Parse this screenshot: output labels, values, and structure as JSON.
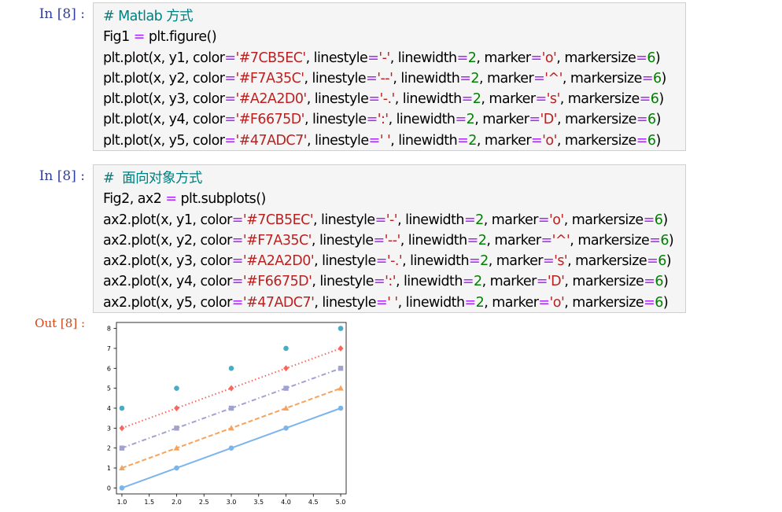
{
  "cells": [
    {
      "prompt": "In [8] :",
      "lines": [
        [
          {
            "t": "# Matlab 方式",
            "c": "comment"
          }
        ],
        [
          {
            "t": "Fig1 "
          },
          {
            "t": "=",
            "c": "op"
          },
          {
            "t": " plt.figure()"
          }
        ],
        [
          {
            "t": "plt.plot(x, y1, color"
          },
          {
            "t": "=",
            "c": "op"
          },
          {
            "t": "'#7CB5EC'",
            "c": "str"
          },
          {
            "t": ", linestyle"
          },
          {
            "t": "=",
            "c": "op"
          },
          {
            "t": "'-'",
            "c": "str"
          },
          {
            "t": ", linewidth"
          },
          {
            "t": "=",
            "c": "op"
          },
          {
            "t": "2",
            "c": "num"
          },
          {
            "t": ", marker"
          },
          {
            "t": "=",
            "c": "op"
          },
          {
            "t": "'o'",
            "c": "str"
          },
          {
            "t": ", markersize"
          },
          {
            "t": "=",
            "c": "op"
          },
          {
            "t": "6",
            "c": "num"
          },
          {
            "t": ")"
          }
        ],
        [
          {
            "t": "plt.plot(x, y2, color"
          },
          {
            "t": "=",
            "c": "op"
          },
          {
            "t": "'#F7A35C'",
            "c": "str"
          },
          {
            "t": ", linestyle"
          },
          {
            "t": "=",
            "c": "op"
          },
          {
            "t": "'--'",
            "c": "str"
          },
          {
            "t": ", linewidth"
          },
          {
            "t": "=",
            "c": "op"
          },
          {
            "t": "2",
            "c": "num"
          },
          {
            "t": ", marker"
          },
          {
            "t": "=",
            "c": "op"
          },
          {
            "t": "'^'",
            "c": "str"
          },
          {
            "t": ", markersize"
          },
          {
            "t": "=",
            "c": "op"
          },
          {
            "t": "6",
            "c": "num"
          },
          {
            "t": ")"
          }
        ],
        [
          {
            "t": "plt.plot(x, y3, color"
          },
          {
            "t": "=",
            "c": "op"
          },
          {
            "t": "'#A2A2D0'",
            "c": "str"
          },
          {
            "t": ", linestyle"
          },
          {
            "t": "=",
            "c": "op"
          },
          {
            "t": "'-.'",
            "c": "str"
          },
          {
            "t": ", linewidth"
          },
          {
            "t": "=",
            "c": "op"
          },
          {
            "t": "2",
            "c": "num"
          },
          {
            "t": ", marker"
          },
          {
            "t": "=",
            "c": "op"
          },
          {
            "t": "'s'",
            "c": "str"
          },
          {
            "t": ", markersize"
          },
          {
            "t": "=",
            "c": "op"
          },
          {
            "t": "6",
            "c": "num"
          },
          {
            "t": ")"
          }
        ],
        [
          {
            "t": "plt.plot(x, y4, color"
          },
          {
            "t": "=",
            "c": "op"
          },
          {
            "t": "'#F6675D'",
            "c": "str"
          },
          {
            "t": ", linestyle"
          },
          {
            "t": "=",
            "c": "op"
          },
          {
            "t": "':'",
            "c": "str"
          },
          {
            "t": ", linewidth"
          },
          {
            "t": "=",
            "c": "op"
          },
          {
            "t": "2",
            "c": "num"
          },
          {
            "t": ", marker"
          },
          {
            "t": "=",
            "c": "op"
          },
          {
            "t": "'D'",
            "c": "str"
          },
          {
            "t": ", markersize"
          },
          {
            "t": "=",
            "c": "op"
          },
          {
            "t": "6",
            "c": "num"
          },
          {
            "t": ")"
          }
        ],
        [
          {
            "t": "plt.plot(x, y5, color"
          },
          {
            "t": "=",
            "c": "op"
          },
          {
            "t": "'#47ADC7'",
            "c": "str"
          },
          {
            "t": ", linestyle"
          },
          {
            "t": "=",
            "c": "op"
          },
          {
            "t": "' '",
            "c": "str"
          },
          {
            "t": ", linewidth"
          },
          {
            "t": "=",
            "c": "op"
          },
          {
            "t": "2",
            "c": "num"
          },
          {
            "t": ", marker"
          },
          {
            "t": "=",
            "c": "op"
          },
          {
            "t": "'o'",
            "c": "str"
          },
          {
            "t": ", markersize"
          },
          {
            "t": "=",
            "c": "op"
          },
          {
            "t": "6",
            "c": "num"
          },
          {
            "t": ")"
          }
        ]
      ]
    },
    {
      "prompt": "In [8] :",
      "lines": [
        [
          {
            "t": "#  面向对象方式",
            "c": "comment"
          }
        ],
        [
          {
            "t": "Fig2, ax2 "
          },
          {
            "t": "=",
            "c": "op"
          },
          {
            "t": " plt.subplots()"
          }
        ],
        [
          {
            "t": "ax2.plot(x, y1, color"
          },
          {
            "t": "=",
            "c": "op"
          },
          {
            "t": "'#7CB5EC'",
            "c": "str"
          },
          {
            "t": ", linestyle"
          },
          {
            "t": "=",
            "c": "op"
          },
          {
            "t": "'-'",
            "c": "str"
          },
          {
            "t": ", linewidth"
          },
          {
            "t": "=",
            "c": "op"
          },
          {
            "t": "2",
            "c": "num"
          },
          {
            "t": ", marker"
          },
          {
            "t": "=",
            "c": "op"
          },
          {
            "t": "'o'",
            "c": "str"
          },
          {
            "t": ", markersize"
          },
          {
            "t": "=",
            "c": "op"
          },
          {
            "t": "6",
            "c": "num"
          },
          {
            "t": ")"
          }
        ],
        [
          {
            "t": "ax2.plot(x, y2, color"
          },
          {
            "t": "=",
            "c": "op"
          },
          {
            "t": "'#F7A35C'",
            "c": "str"
          },
          {
            "t": ", linestyle"
          },
          {
            "t": "=",
            "c": "op"
          },
          {
            "t": "'--'",
            "c": "str"
          },
          {
            "t": ", linewidth"
          },
          {
            "t": "=",
            "c": "op"
          },
          {
            "t": "2",
            "c": "num"
          },
          {
            "t": ", marker"
          },
          {
            "t": "=",
            "c": "op"
          },
          {
            "t": "'^'",
            "c": "str"
          },
          {
            "t": ", markersize"
          },
          {
            "t": "=",
            "c": "op"
          },
          {
            "t": "6",
            "c": "num"
          },
          {
            "t": ")"
          }
        ],
        [
          {
            "t": "ax2.plot(x, y3, color"
          },
          {
            "t": "=",
            "c": "op"
          },
          {
            "t": "'#A2A2D0'",
            "c": "str"
          },
          {
            "t": ", linestyle"
          },
          {
            "t": "=",
            "c": "op"
          },
          {
            "t": "'-.'",
            "c": "str"
          },
          {
            "t": ", linewidth"
          },
          {
            "t": "=",
            "c": "op"
          },
          {
            "t": "2",
            "c": "num"
          },
          {
            "t": ", marker"
          },
          {
            "t": "=",
            "c": "op"
          },
          {
            "t": "'s'",
            "c": "str"
          },
          {
            "t": ", markersize"
          },
          {
            "t": "=",
            "c": "op"
          },
          {
            "t": "6",
            "c": "num"
          },
          {
            "t": ")"
          }
        ],
        [
          {
            "t": "ax2.plot(x, y4, color"
          },
          {
            "t": "=",
            "c": "op"
          },
          {
            "t": "'#F6675D'",
            "c": "str"
          },
          {
            "t": ", linestyle"
          },
          {
            "t": "=",
            "c": "op"
          },
          {
            "t": "':'",
            "c": "str"
          },
          {
            "t": ", linewidth"
          },
          {
            "t": "=",
            "c": "op"
          },
          {
            "t": "2",
            "c": "num"
          },
          {
            "t": ", marker"
          },
          {
            "t": "=",
            "c": "op"
          },
          {
            "t": "'D'",
            "c": "str"
          },
          {
            "t": ", markersize"
          },
          {
            "t": "=",
            "c": "op"
          },
          {
            "t": "6",
            "c": "num"
          },
          {
            "t": ")"
          }
        ],
        [
          {
            "t": "ax2.plot(x, y5, color"
          },
          {
            "t": "=",
            "c": "op"
          },
          {
            "t": "'#47ADC7'",
            "c": "str"
          },
          {
            "t": ", linestyle"
          },
          {
            "t": "=",
            "c": "op"
          },
          {
            "t": "' '",
            "c": "str"
          },
          {
            "t": ", linewidth"
          },
          {
            "t": "=",
            "c": "op"
          },
          {
            "t": "2",
            "c": "num"
          },
          {
            "t": ", marker"
          },
          {
            "t": "=",
            "c": "op"
          },
          {
            "t": "'o'",
            "c": "str"
          },
          {
            "t": ", markersize"
          },
          {
            "t": "=",
            "c": "op"
          },
          {
            "t": "6",
            "c": "num"
          },
          {
            "t": ")"
          }
        ]
      ]
    }
  ],
  "output": {
    "prompt": "Out [8] :"
  },
  "colors": {
    "prompt_in": "#303f9f",
    "prompt_out": "#d84315",
    "comment": "#008080",
    "operator": "#aa22ff",
    "string": "#ba2121",
    "number": "#008000"
  },
  "chart_data": {
    "type": "line",
    "x": [
      1.0,
      2.0,
      3.0,
      4.0,
      5.0
    ],
    "xticks": [
      "1.0",
      "1.5",
      "2.0",
      "2.5",
      "3.0",
      "3.5",
      "4.0",
      "4.5",
      "5.0"
    ],
    "yticks": [
      "0",
      "1",
      "2",
      "3",
      "4",
      "5",
      "6",
      "7",
      "8"
    ],
    "xlim": [
      0.9,
      5.1
    ],
    "ylim": [
      -0.3,
      8.3
    ],
    "grid": false,
    "legend": "none",
    "series": [
      {
        "color": "#7CB5EC",
        "linestyle": "-",
        "marker": "o",
        "values": [
          0,
          1,
          2,
          3,
          4
        ]
      },
      {
        "color": "#F7A35C",
        "linestyle": "--",
        "marker": "^",
        "values": [
          1,
          2,
          3,
          4,
          5
        ]
      },
      {
        "color": "#A2A2D0",
        "linestyle": "-.",
        "marker": "s",
        "values": [
          2,
          3,
          4,
          5,
          6
        ]
      },
      {
        "color": "#F6675D",
        "linestyle": ":",
        "marker": "D",
        "values": [
          3,
          4,
          5,
          6,
          7
        ]
      },
      {
        "color": "#47ADC7",
        "linestyle": " ",
        "marker": "o",
        "values": [
          4,
          5,
          6,
          7,
          8
        ]
      }
    ]
  }
}
